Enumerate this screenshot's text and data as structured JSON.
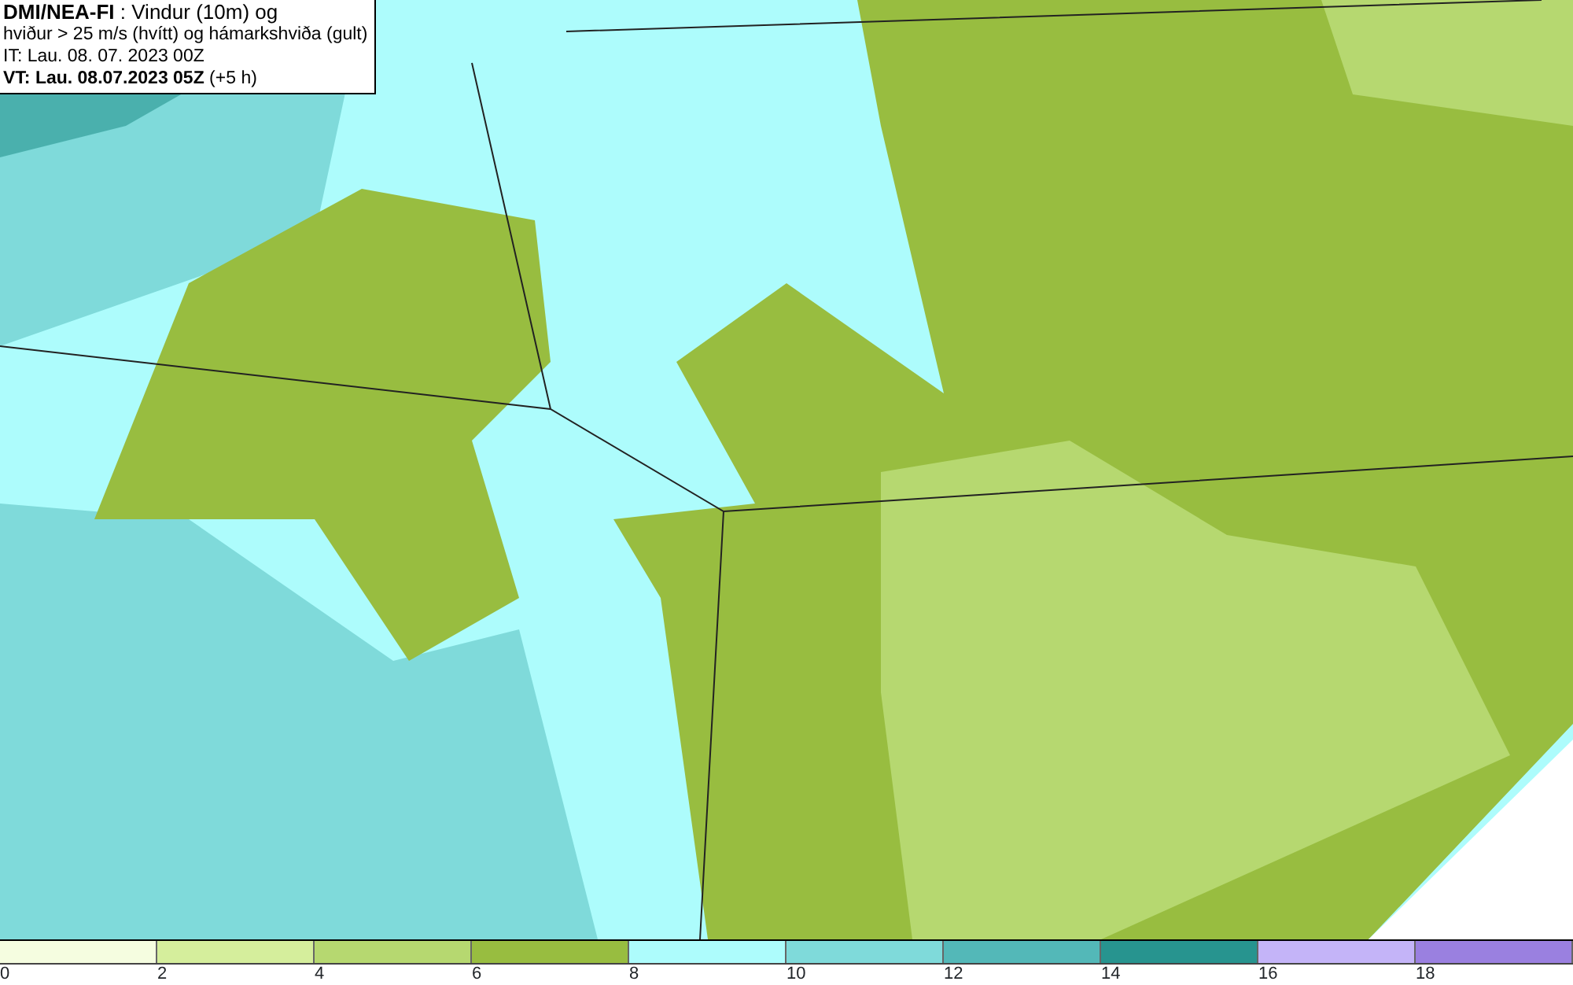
{
  "title_box": {
    "lines": [
      "**DMI/NEA-FI** : Vindur (10m) og",
      "hviður > 25 m/s (hvítt) og hámarkshviða (gult)",
      "IT: Lau. 08. 07. 2023 00Z",
      "**VT: Lau. 08.07.2023 05Z** (+5 h)"
    ]
  },
  "legend": {
    "bins": [
      {
        "color": "#f5fde0"
      },
      {
        "color": "#d5ee9c"
      },
      {
        "color": "#b6d870"
      },
      {
        "color": "#98bd40"
      },
      {
        "color": "#adfcfc"
      },
      {
        "color": "#7fdada"
      },
      {
        "color": "#53b8b8"
      },
      {
        "color": "#27948f"
      },
      {
        "color": "#c4b4f8"
      },
      {
        "color": "#9a80e0"
      }
    ],
    "ticks": [
      "0",
      "2",
      "4",
      "6",
      "8",
      "10",
      "12",
      "14",
      "16",
      "18"
    ]
  }
}
